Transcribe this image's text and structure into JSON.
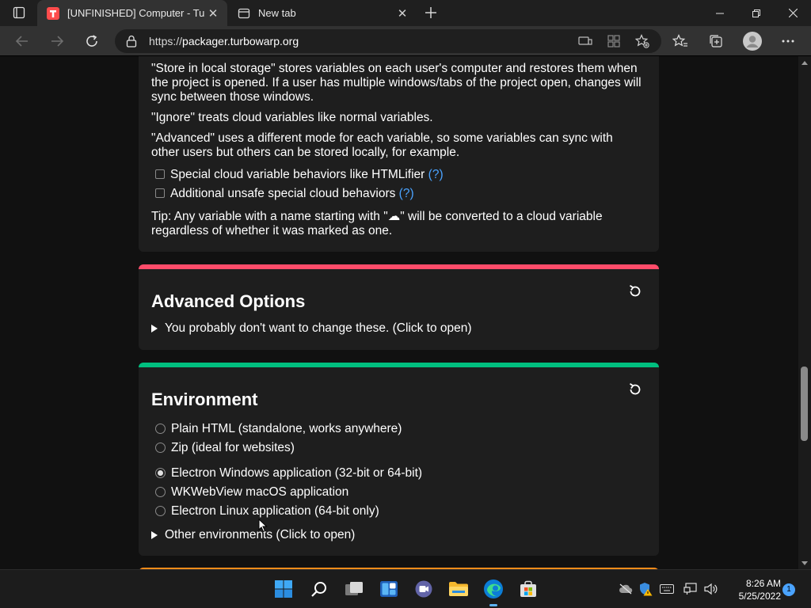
{
  "browser": {
    "tabs": [
      {
        "title": "[UNFINISHED] Computer - TurboWarp Packager",
        "active": true
      },
      {
        "title": "New tab",
        "active": false
      }
    ],
    "url_scheme": "https://",
    "url_host": "packager.turbowarp.org"
  },
  "page": {
    "cloud": {
      "p1": "\"Store in local storage\" stores variables on each user's computer and restores them when the project is opened. If a user has multiple windows/tabs of the project open, changes will sync between those windows.",
      "p2": "\"Ignore\" treats cloud variables like normal variables.",
      "p3": "\"Advanced\" uses a different mode for each variable, so some variables can sync with other users but others can be stored locally, for example.",
      "checkbox1": {
        "label": "Special cloud variable behaviors like HTMLifier",
        "help": "(?)",
        "checked": false
      },
      "checkbox2": {
        "label": "Additional unsafe special cloud behaviors",
        "help": "(?)",
        "checked": false
      },
      "tip": "Tip: Any variable with a name starting with \"☁\" will be converted to a cloud variable regardless of whether it was marked as one."
    },
    "advanced": {
      "title": "Advanced Options",
      "summary": "You probably don't want to change these. (Click to open)",
      "accent": "#ff4c6a"
    },
    "environment": {
      "title": "Environment",
      "accent": "#00bf7f",
      "options": [
        {
          "label": "Plain HTML (standalone, works anywhere)",
          "checked": false
        },
        {
          "label": "Zip (ideal for websites)",
          "checked": false
        },
        {
          "label": "Electron Windows application (32-bit or 64-bit)",
          "checked": true
        },
        {
          "label": "WKWebView macOS application",
          "checked": false
        },
        {
          "label": "Electron Linux application (64-bit only)",
          "checked": false
        }
      ],
      "summary": "Other environments (Click to open)"
    },
    "next_accent": "#ff8c1a"
  },
  "taskbar": {
    "time": "8:26 AM",
    "date": "5/25/2022",
    "notifications": "1"
  }
}
